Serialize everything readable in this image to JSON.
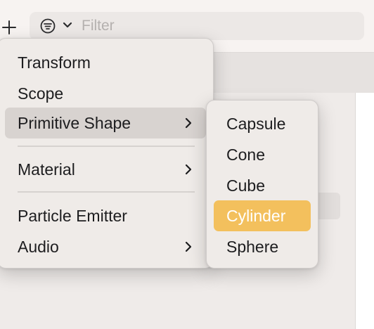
{
  "toolbar": {
    "add_icon": "plus-icon",
    "filter_icon": "line-filter-icon",
    "chevron_icon": "chevron-down-icon",
    "filter_placeholder": "Filter"
  },
  "menu": {
    "items": [
      {
        "label": "Transform",
        "has_submenu": false
      },
      {
        "label": "Scope",
        "has_submenu": false
      },
      {
        "label": "Primitive Shape",
        "has_submenu": true,
        "highlighted": true
      },
      {
        "label": "Material",
        "has_submenu": true
      },
      {
        "label": "Particle Emitter",
        "has_submenu": false
      },
      {
        "label": "Audio",
        "has_submenu": true
      }
    ],
    "chevron_icon": "chevron-right-icon"
  },
  "submenu": {
    "items": [
      {
        "label": "Capsule"
      },
      {
        "label": "Cone"
      },
      {
        "label": "Cube"
      },
      {
        "label": "Cylinder",
        "selected": true
      },
      {
        "label": "Sphere"
      }
    ]
  },
  "colors": {
    "selection_accent": "#f3c05d",
    "hover_row": "#d8d3d0",
    "menu_background": "#efebe8"
  }
}
